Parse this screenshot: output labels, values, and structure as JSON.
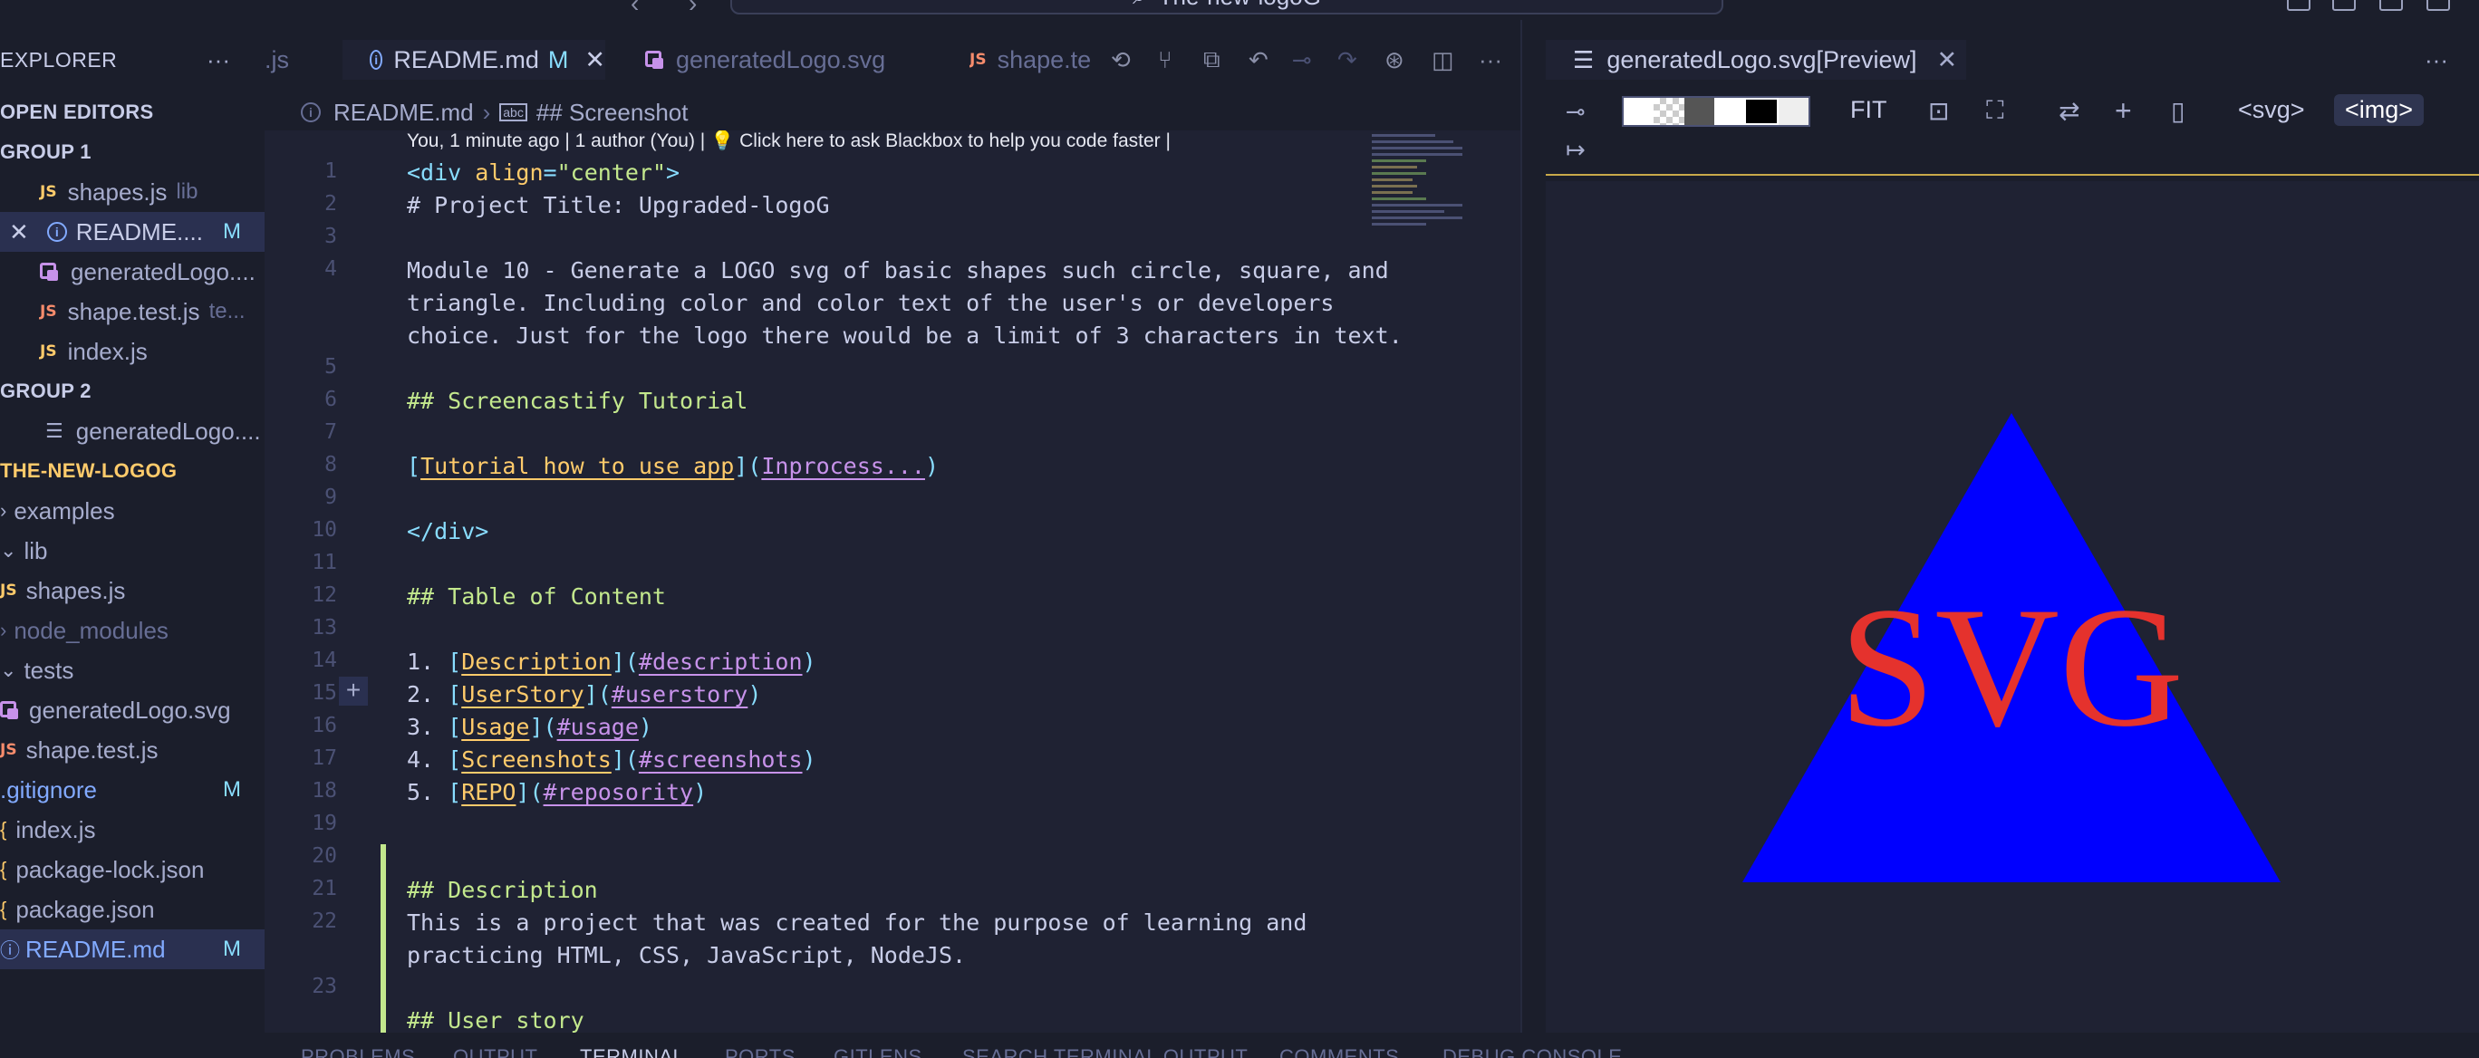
{
  "window": {
    "command_center": "The-new-logoG"
  },
  "sidebar": {
    "title": "EXPLORER",
    "more": "···",
    "open_editors": "OPEN EDITORS",
    "group1": "GROUP 1",
    "group1_items": [
      {
        "icon": "JS",
        "name": "shapes.js",
        "hint": "lib"
      },
      {
        "name": "README....",
        "badge": "M"
      },
      {
        "name": "generatedLogo...."
      },
      {
        "icon": "JS",
        "name": "shape.test.js",
        "hint": "te..."
      },
      {
        "icon": "JS",
        "name": "index.js"
      }
    ],
    "group2": "GROUP 2",
    "group2_items": [
      {
        "name": "generatedLogo...."
      }
    ],
    "project": "THE-NEW-LOGOG",
    "tree": [
      {
        "name": "examples"
      },
      {
        "name": "lib"
      },
      {
        "icon": "JS",
        "name": "shapes.js"
      },
      {
        "name": "node_modules"
      },
      {
        "name": "tests"
      },
      {
        "name": "generatedLogo.svg"
      },
      {
        "icon": "JS",
        "name": "shape.test.js"
      },
      {
        "name": ".gitignore",
        "badge": "M"
      },
      {
        "name": "index.js"
      },
      {
        "name": "package-lock.json"
      },
      {
        "name": "package.json"
      },
      {
        "name": "README.md",
        "badge": "M"
      }
    ]
  },
  "tabs": [
    {
      "label": ".js"
    },
    {
      "label": "README.md",
      "badge": "M"
    },
    {
      "label": "generatedLogo.svg"
    },
    {
      "label": "shape.te"
    }
  ],
  "breadcrumb": {
    "file": "README.md",
    "section": "## Screenshot"
  },
  "blame": "You, 1 minute ago | 1 author (You) | 💡 Click here to ask Blackbox to help you code faster |",
  "lines": {
    "l1a": "<div ",
    "l1b": "align",
    "l1c": "=",
    "l1d": "\"center\"",
    "l1e": ">",
    "l2": "# Project Title: Upgraded-logoG",
    "l4a": "Module 10 - Generate a LOGO svg of basic shapes such circle, square, and",
    "l4b": "triangle. Including color and color text of the user's or developers",
    "l4c": "choice. Just for the logo there would be a limit of 3 characters in text.",
    "l6": "## Screencastify Tutorial",
    "l8_link": "Tutorial how to use app",
    "l8_url": "Inprocess...",
    "l10": "</div>",
    "l12": "## Table of Content",
    "toc": [
      {
        "n": "1. ",
        "text": "Description",
        "url": "#description"
      },
      {
        "n": "2. ",
        "text": "UserStory",
        "url": "#userstory"
      },
      {
        "n": "3. ",
        "text": "Usage",
        "url": "#usage"
      },
      {
        "n": "4. ",
        "text": "Screenshots",
        "url": "#screenshots"
      },
      {
        "n": "5. ",
        "text": "REPO",
        "url": "#reposority"
      }
    ],
    "l21": "## Description",
    "l22a": "This is a project that was created for the purpose of learning and",
    "l22b": "practicing HTML, CSS, JavaScript, NodeJS.",
    "l24": "## User story"
  },
  "line_numbers": [
    "1",
    "2",
    "3",
    "4",
    "5",
    "6",
    "7",
    "8",
    "9",
    "10",
    "11",
    "12",
    "13",
    "14",
    "15",
    "16",
    "17",
    "18",
    "19",
    "20",
    "21",
    "22",
    "23"
  ],
  "preview": {
    "tab_label": "generatedLogo.svg[Preview]",
    "fit": "FIT",
    "svg_btn": "<svg>",
    "img_btn": "<img>",
    "logo_text": "SVG",
    "colors": {
      "shape": "#0000ff",
      "text": "#e5322d"
    }
  },
  "panel_tabs": [
    "PROBLEMS",
    "OUTPUT",
    "TERMINAL",
    "PORTS",
    "GITLENS",
    "SEARCH TERMINAL OUTPUT",
    "COMMENTS",
    "DEBUG CONSOLE"
  ]
}
